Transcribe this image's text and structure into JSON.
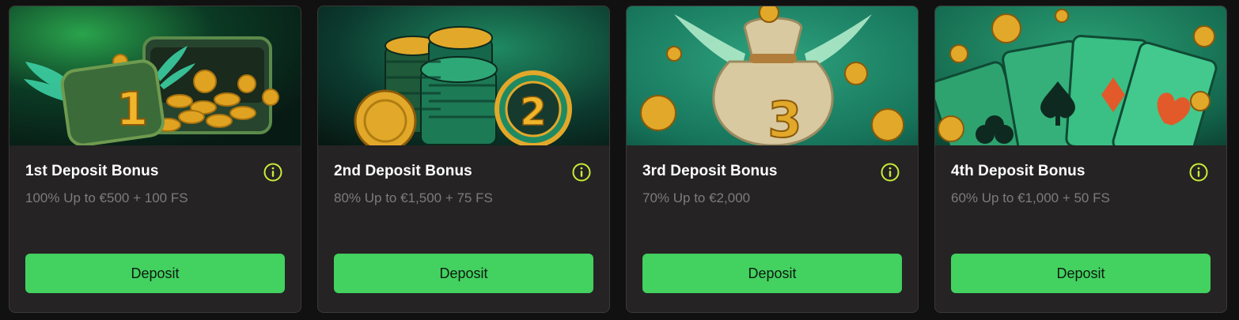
{
  "cards": [
    {
      "title": "1st Deposit Bonus",
      "subtitle": "100% Up to €500 + 100 FS",
      "button": "Deposit",
      "art_number": "1",
      "art_label": "treasure-chest-art"
    },
    {
      "title": "2nd Deposit Bonus",
      "subtitle": "80% Up to €1,500 + 75 FS",
      "button": "Deposit",
      "art_number": "2",
      "art_label": "casino-chips-art"
    },
    {
      "title": "3rd Deposit Bonus",
      "subtitle": "70% Up to €2,000",
      "button": "Deposit",
      "art_number": "3",
      "art_label": "money-bag-art"
    },
    {
      "title": "4th Deposit Bonus",
      "subtitle": "60% Up to €1,000 + 50 FS",
      "button": "Deposit",
      "art_number": "",
      "art_label": "playing-cards-art"
    }
  ],
  "colors": {
    "accent": "#43d160",
    "info_icon": "#c9ec3a",
    "card_bg": "#252323",
    "page_bg": "#111111"
  },
  "icons": {
    "info": "info-icon"
  }
}
